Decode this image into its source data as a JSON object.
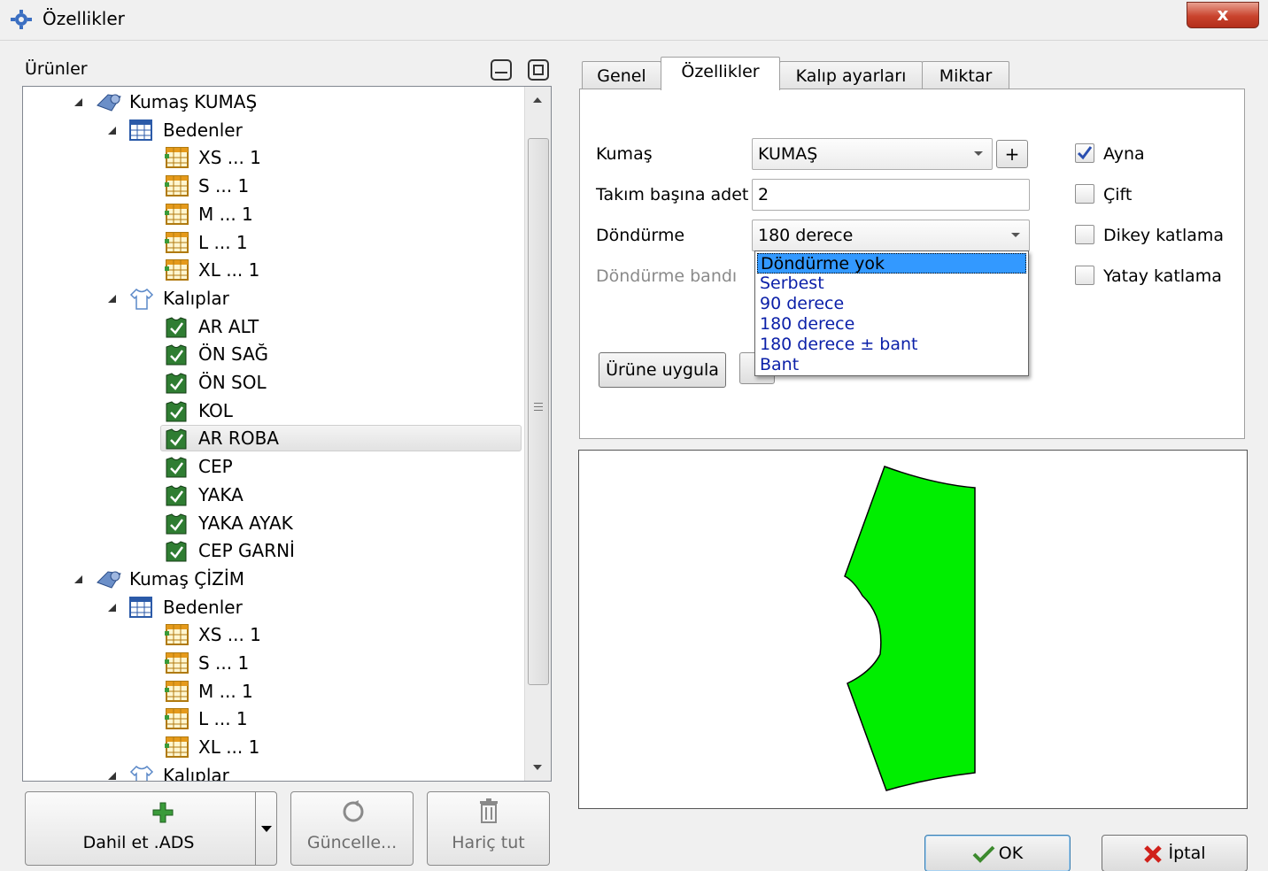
{
  "window": {
    "title": "Özellikler",
    "close_label": "x"
  },
  "left_panel": {
    "label": "Ürünler",
    "tree": [
      {
        "level": 0,
        "icon": "fabric-roll-icon",
        "label": "Kumaş KUMAŞ",
        "expanded": true
      },
      {
        "level": 1,
        "icon": "table-icon",
        "label": "Bedenler",
        "expanded": true
      },
      {
        "level": 2,
        "icon": "size-table-icon",
        "label": "XS ... 1"
      },
      {
        "level": 2,
        "icon": "size-table-icon",
        "label": "S ... 1"
      },
      {
        "level": 2,
        "icon": "size-table-icon",
        "label": "M ... 1"
      },
      {
        "level": 2,
        "icon": "size-table-icon",
        "label": "L ... 1"
      },
      {
        "level": 2,
        "icon": "size-table-icon",
        "label": "XL ... 1"
      },
      {
        "level": 1,
        "icon": "shirt-outline-icon",
        "label": "Kalıplar",
        "expanded": true
      },
      {
        "level": 2,
        "icon": "pattern-piece-icon",
        "label": "AR ALT"
      },
      {
        "level": 2,
        "icon": "pattern-piece-icon",
        "label": "ÖN SAĞ"
      },
      {
        "level": 2,
        "icon": "pattern-piece-icon",
        "label": "ÖN SOL"
      },
      {
        "level": 2,
        "icon": "pattern-piece-icon",
        "label": "KOL"
      },
      {
        "level": 2,
        "icon": "pattern-piece-icon",
        "label": "AR ROBA",
        "selected": true
      },
      {
        "level": 2,
        "icon": "pattern-piece-icon",
        "label": "CEP"
      },
      {
        "level": 2,
        "icon": "pattern-piece-icon",
        "label": "YAKA"
      },
      {
        "level": 2,
        "icon": "pattern-piece-icon",
        "label": "YAKA AYAK"
      },
      {
        "level": 2,
        "icon": "pattern-piece-icon",
        "label": "CEP GARNİ"
      },
      {
        "level": 0,
        "icon": "fabric-roll-icon",
        "label": "Kumaş ÇİZİM",
        "expanded": true
      },
      {
        "level": 1,
        "icon": "table-icon",
        "label": "Bedenler",
        "expanded": true
      },
      {
        "level": 2,
        "icon": "size-table-icon",
        "label": "XS ... 1"
      },
      {
        "level": 2,
        "icon": "size-table-icon",
        "label": "S ... 1"
      },
      {
        "level": 2,
        "icon": "size-table-icon",
        "label": "M ... 1"
      },
      {
        "level": 2,
        "icon": "size-table-icon",
        "label": "L ... 1"
      },
      {
        "level": 2,
        "icon": "size-table-icon",
        "label": "XL ... 1"
      },
      {
        "level": 1,
        "icon": "shirt-outline-icon",
        "label": "Kalıplar",
        "expanded": true
      }
    ],
    "buttons": {
      "include": "Dahil et .ADS",
      "update": "Güncelle...",
      "exclude": "Hariç tut"
    }
  },
  "tabs": [
    {
      "label": "Genel",
      "active": false
    },
    {
      "label": "Özellikler",
      "active": true
    },
    {
      "label": "Kalıp ayarları",
      "active": false
    },
    {
      "label": "Miktar",
      "active": false
    }
  ],
  "properties": {
    "fabric_label": "Kumaş",
    "fabric_value": "KUMAŞ",
    "add_label": "+",
    "per_set_label": "Takım başına adet",
    "per_set_value": "2",
    "rotation_label": "Döndürme",
    "rotation_value": "180 derece",
    "rotation_band_label": "Döndürme bandı",
    "apply_label": "Ürüne uygula",
    "rotation_options": [
      "Döndürme yok",
      "Serbest",
      "90 derece",
      "180 derece",
      "180 derece ± bant",
      "Bant"
    ],
    "highlighted_option": 0,
    "checkboxes": [
      {
        "label": "Ayna",
        "checked": true
      },
      {
        "label": "Çift",
        "checked": false
      },
      {
        "label": "Dikey katlama",
        "checked": false
      },
      {
        "label": "Yatay katlama",
        "checked": false
      }
    ]
  },
  "preview": {
    "piece_color": "#00ee00"
  },
  "footer": {
    "ok": "OK",
    "cancel": "İptal"
  }
}
